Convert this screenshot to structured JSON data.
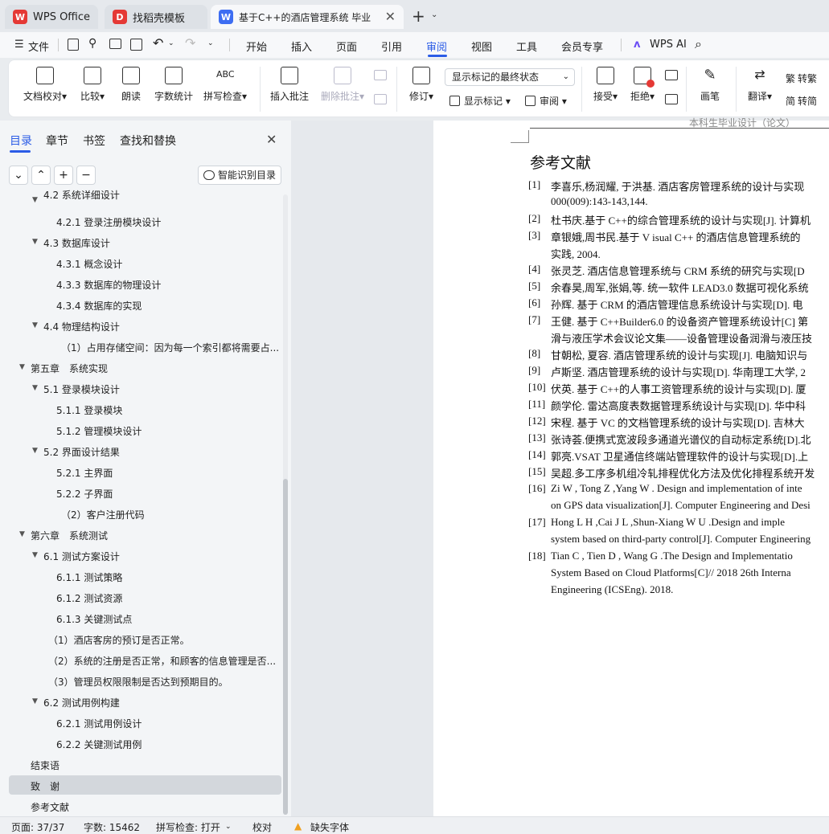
{
  "tabs": [
    {
      "label": "WPS Office",
      "logo": "W",
      "color": "#e53935"
    },
    {
      "label": "找稻壳模板",
      "logo": "D",
      "color": "#e53935"
    },
    {
      "label": "基于C++的酒店管理系统 毕业",
      "logo": "W",
      "color": "#3d6df2"
    }
  ],
  "menu": {
    "file_label": "文件",
    "items": [
      "开始",
      "插入",
      "页面",
      "引用",
      "审阅",
      "视图",
      "工具",
      "会员专享"
    ],
    "active": "审阅",
    "ai_label": "WPS AI"
  },
  "ribbon": {
    "buttons": [
      "文档校对",
      "比较",
      "朗读",
      "字数统计",
      "拼写检查",
      "插入批注",
      "删除批注",
      "修订",
      "接受",
      "拒绝",
      "画笔",
      "翻译"
    ],
    "display_select": "显示标记的最终状态",
    "show_markup": "显示标记",
    "review_label": "审阅",
    "trad": "转繁",
    "simp": "转简"
  },
  "nav": {
    "tabs": [
      "目录",
      "章节",
      "书签",
      "查找和替换"
    ],
    "smart_label": "智能识别目录"
  },
  "toc": [
    "4.2 系统详细设计",
    "4.2.1 登录注册模块设计",
    "4.3 数据库设计",
    "4.3.1 概念设计",
    "4.3.3 数据库的物理设计",
    "4.3.4 数据库的实现",
    "4.4 物理结构设计",
    "（1）占用存储空间：因为每一个索引都将需要占...",
    "第五章　系统实现",
    "5.1 登录模块设计",
    "5.1.1 登录模块",
    "5.1.2 管理模块设计",
    "5.2 界面设计结果",
    "5.2.1 主界面",
    "5.2.2 子界面",
    "（2）客户注册代码",
    "第六章　系统测试",
    "6.1 测试方案设计",
    "6.1.1 测试策略",
    "6.1.2 测试资源",
    "6.1.3 关键测试点",
    "（1）酒店客房的预订是否正常。",
    "（2）系统的注册是否正常，和顾客的信息管理是否...",
    "（3）管理员权限限制是否达到预期目的。",
    "6.2 测试用例构建",
    "6.2.1 测试用例设计",
    "6.2.2 关键测试用例",
    "结束语",
    "致　谢",
    "参考文献"
  ],
  "doc": {
    "header": "本科生毕业设计（论文）",
    "heading": "参考文献",
    "refs": [
      {
        "n": "[1]",
        "lines": [
          "李喜乐,杨润耀, 于洪基. 酒店客房管理系统的设计与实现",
          "000(009):143-143,144."
        ]
      },
      {
        "n": "[2]",
        "lines": [
          "杜书庆.基于 C++的综合管理系统的设计与实现[J]. 计算机"
        ]
      },
      {
        "n": "[3]",
        "lines": [
          "章银娥,周书民.基于 V isual C++ 的酒店信息管理系统的",
          "实践, 2004."
        ]
      },
      {
        "n": "[4]",
        "lines": [
          "张灵芝. 酒店信息管理系统与 CRM 系统的研究与实现[D"
        ]
      },
      {
        "n": "[5]",
        "lines": [
          "余春昊,周军,张娟,等. 统一软件 LEAD3.0 数据可视化系统"
        ]
      },
      {
        "n": "[6]",
        "lines": [
          "孙辉. 基于 CRM 的酒店管理信息系统设计与实现[D]. 电"
        ]
      },
      {
        "n": "[7]",
        "lines": [
          "王健. 基于 C++Builder6.0 的设备资产管理系统设计[C] 第",
          "滑与液压学术会议论文集——设备管理设备润滑与液压技"
        ]
      },
      {
        "n": "[8]",
        "lines": [
          "甘朝松, 夏容. 酒店管理系统的设计与实现[J]. 电脑知识与"
        ]
      },
      {
        "n": "[9]",
        "lines": [
          "卢斯坚. 酒店管理系统的设计与实现[D]. 华南理工大学, 2"
        ]
      },
      {
        "n": "[10]",
        "lines": [
          "伏英. 基于 C++的人事工资管理系统的设计与实现[D]. 厦"
        ]
      },
      {
        "n": "[11]",
        "lines": [
          "颜学伦. 雷达高度表数据管理系统设计与实现[D]. 华中科"
        ]
      },
      {
        "n": "[12]",
        "lines": [
          "宋程. 基于 VC 的文档管理系统的设计与实现[D]. 吉林大"
        ]
      },
      {
        "n": "[13]",
        "lines": [
          "张诗荟.便携式宽波段多通道光谱仪的自动标定系统[D].北"
        ]
      },
      {
        "n": "[14]",
        "lines": [
          "郭亮.VSAT 卫星通信终端站管理软件的设计与实现[D].上"
        ]
      },
      {
        "n": "[15]",
        "lines": [
          "吴超.多工序多机组冷轧排程优化方法及优化排程系统开发"
        ]
      },
      {
        "n": "[16]",
        "lines": [
          "Zi W , Tong Z ,Yang W . Design and implementation of inte",
          "on GPS data visualization[J]. Computer Engineering and Desi"
        ]
      },
      {
        "n": "[17]",
        "lines": [
          "Hong L H ,Cai J L ,Shun-Xiang W U .Design and imple",
          "system based on third-party control[J]. Computer Engineering"
        ]
      },
      {
        "n": "[18]",
        "lines": [
          "Tian C , Tien D , Wang G .The Design and Implementatio",
          "System Based on Cloud Platforms[C]// 2018 26th Interna",
          "Engineering (ICSEng). 2018."
        ]
      }
    ]
  },
  "status": {
    "page": "页面: 37/37",
    "words": "字数: 15462",
    "spell": "拼写检查: 打开",
    "proof": "校对",
    "font_warn": "缺失字体"
  }
}
